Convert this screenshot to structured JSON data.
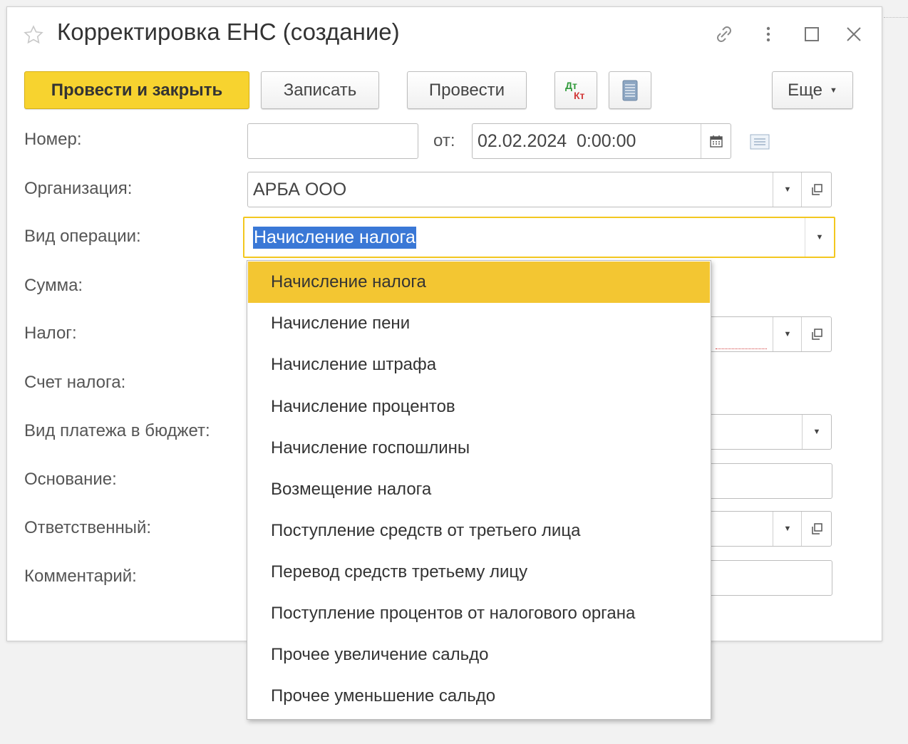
{
  "window": {
    "title": "Корректировка ЕНС (создание)"
  },
  "toolbar": {
    "post_close_label": "Провести и закрыть",
    "save_label": "Записать",
    "post_label": "Провести",
    "dtkt_top": "Дт",
    "dtkt_bottom": "Кт",
    "more_label": "Еще"
  },
  "form": {
    "number_label": "Номер:",
    "number_value": "",
    "date_from_label": "от:",
    "date_value": "02.02.2024  0:00:00",
    "org_label": "Организация:",
    "org_value": "АРБА ООО",
    "op_type_label": "Вид операции:",
    "op_type_value": "Начисление налога",
    "sum_label": "Сумма:",
    "tax_label": "Налог:",
    "tax_account_label": "Счет налога:",
    "payment_type_label": "Вид платежа в бюджет:",
    "basis_label": "Основание:",
    "responsible_label": "Ответственный:",
    "comment_label": "Комментарий:"
  },
  "dropdown": {
    "selected_index": 0,
    "items": [
      "Начисление налога",
      "Начисление пени",
      "Начисление штрафа",
      "Начисление процентов",
      "Начисление госпошлины",
      "Возмещение налога",
      "Поступление средств от третьего лица",
      "Перевод средств третьему лицу",
      "Поступление процентов от налогового органа",
      "Прочее увеличение сальдо",
      "Прочее уменьшение сальдо"
    ]
  },
  "colors": {
    "accent": "#f7d32f",
    "highlight": "#f3c632",
    "selection": "#3a78d6"
  }
}
